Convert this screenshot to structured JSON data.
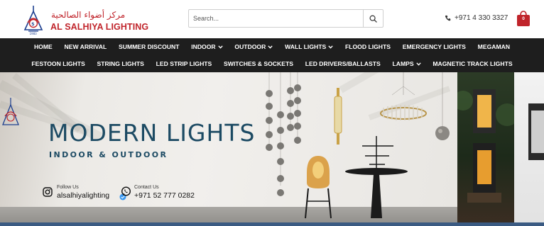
{
  "brand": {
    "name_ar": "مركز أضواء الصالحية",
    "name_en": "AL SALHIYA LIGHTING"
  },
  "search": {
    "placeholder": "Search..."
  },
  "contact_top": {
    "phone": "+971 4 330 3327"
  },
  "cart": {
    "count": "0"
  },
  "nav": {
    "row1": [
      {
        "label": "HOME",
        "dropdown": false
      },
      {
        "label": "NEW ARRIVAL",
        "dropdown": false
      },
      {
        "label": "SUMMER DISCOUNT",
        "dropdown": false
      },
      {
        "label": "INDOOR",
        "dropdown": true
      },
      {
        "label": "OUTDOOR",
        "dropdown": true
      },
      {
        "label": "WALL LIGHTS",
        "dropdown": true
      },
      {
        "label": "FLOOD LIGHTS",
        "dropdown": false
      },
      {
        "label": "EMERGENCY LIGHTS",
        "dropdown": false
      },
      {
        "label": "MEGAMAN",
        "dropdown": false
      }
    ],
    "row2": [
      {
        "label": "FESTOON LIGHTS",
        "dropdown": false
      },
      {
        "label": "STRING LIGHTS",
        "dropdown": false
      },
      {
        "label": "LED STRIP LIGHTS",
        "dropdown": false
      },
      {
        "label": "SWITCHES & SOCKETS",
        "dropdown": false
      },
      {
        "label": "LED DRIVERS/BALLASTS",
        "dropdown": false
      },
      {
        "label": "LAMPS",
        "dropdown": true
      },
      {
        "label": "MAGNETIC TRACK LIGHTS",
        "dropdown": false
      }
    ]
  },
  "hero": {
    "title": "MODERN LIGHTS",
    "subtitle": "INDOOR & OUTDOOR",
    "follow_label": "Follow Us",
    "follow_handle": "alsalhiyalighting",
    "contact_label": "Contact Us",
    "contact_number": "+971 52 777 0282"
  },
  "colors": {
    "brand_red": "#c0242b",
    "nav_bg": "#1e1e1e",
    "title_blue": "#1c4a63"
  }
}
